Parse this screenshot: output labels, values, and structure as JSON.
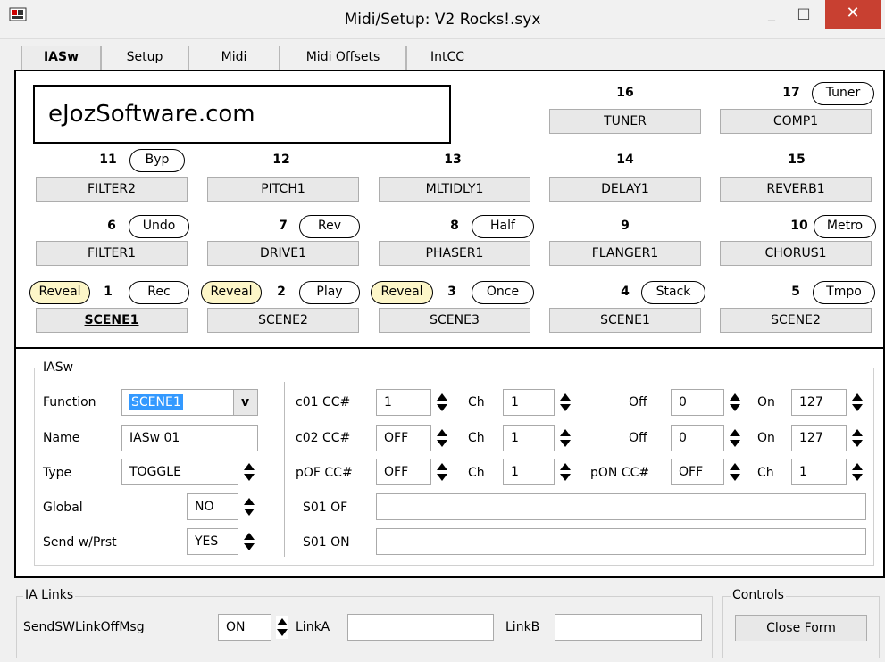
{
  "window": {
    "title": "Midi/Setup: V2 Rocks!.syx",
    "minimize": "_",
    "maximize": "□",
    "close": "✕"
  },
  "tabs": [
    "IASw",
    "Setup",
    "Midi",
    "Midi Offsets",
    "IntCC"
  ],
  "logo_text": "eJozSoftware.com",
  "switches_row0": [
    {
      "num": "16",
      "label": "TUNER",
      "pill": ""
    },
    {
      "num": "17",
      "label": "COMP1",
      "pill": "Tuner"
    }
  ],
  "switches_row1": [
    {
      "num": "11",
      "label": "FILTER2",
      "pill": "Byp"
    },
    {
      "num": "12",
      "label": "PITCH1",
      "pill": ""
    },
    {
      "num": "13",
      "label": "MLTIDLY1",
      "pill": ""
    },
    {
      "num": "14",
      "label": "DELAY1",
      "pill": ""
    },
    {
      "num": "15",
      "label": "REVERB1",
      "pill": ""
    }
  ],
  "switches_row2": [
    {
      "num": "6",
      "label": "FILTER1",
      "pill": "Undo"
    },
    {
      "num": "7",
      "label": "DRIVE1",
      "pill": "Rev"
    },
    {
      "num": "8",
      "label": "PHASER1",
      "pill": "Half"
    },
    {
      "num": "9",
      "label": "FLANGER1",
      "pill": ""
    },
    {
      "num": "10",
      "label": "CHORUS1",
      "pill": "Metro"
    }
  ],
  "switches_row3": [
    {
      "num": "1",
      "label": "SCENE1",
      "pill": "Rec",
      "reveal": "Reveal"
    },
    {
      "num": "2",
      "label": "SCENE2",
      "pill": "Play",
      "reveal": "Reveal"
    },
    {
      "num": "3",
      "label": "SCENE3",
      "pill": "Once",
      "reveal": "Reveal"
    },
    {
      "num": "4",
      "label": "SCENE1",
      "pill": "Stack",
      "reveal": ""
    },
    {
      "num": "5",
      "label": "SCENE2",
      "pill": "Tmpo",
      "reveal": ""
    }
  ],
  "iasw": {
    "group_label": "IASw",
    "function_label": "Function",
    "function_value": "SCENE1",
    "function_btn": "v",
    "name_label": "Name",
    "name_value": "IASw 01",
    "type_label": "Type",
    "type_value": "TOGGLE",
    "global_label": "Global",
    "global_value": "NO",
    "sendwprst_label": "Send w/Prst",
    "sendwprst_value": "YES",
    "c01_label": "c01 CC#",
    "c01_value": "1",
    "c01_ch_label": "Ch",
    "c01_ch_value": "1",
    "c01_off_label": "Off",
    "c01_off_value": "0",
    "c01_on_label": "On",
    "c01_on_value": "127",
    "c02_label": "c02 CC#",
    "c02_value": "OFF",
    "c02_ch_label": "Ch",
    "c02_ch_value": "1",
    "c02_off_label": "Off",
    "c02_off_value": "0",
    "c02_on_label": "On",
    "c02_on_value": "127",
    "pof_label": "pOF CC#",
    "pof_value": "OFF",
    "pof_ch_label": "Ch",
    "pof_ch_value": "1",
    "pon_label": "pON CC#",
    "pon_value": "OFF",
    "pon_ch_label": "Ch",
    "pon_ch_value": "1",
    "s01of_label": "S01 OF",
    "s01of_value": "",
    "s01on_label": "S01 ON",
    "s01on_value": ""
  },
  "ialinks": {
    "group_label": "IA Links",
    "send_label": "SendSWLinkOffMsg",
    "send_value": "ON",
    "linka_label": "LinkA",
    "linka_value": "",
    "linkb_label": "LinkB",
    "linkb_value": ""
  },
  "controls": {
    "group_label": "Controls",
    "close_form": "Close Form"
  }
}
